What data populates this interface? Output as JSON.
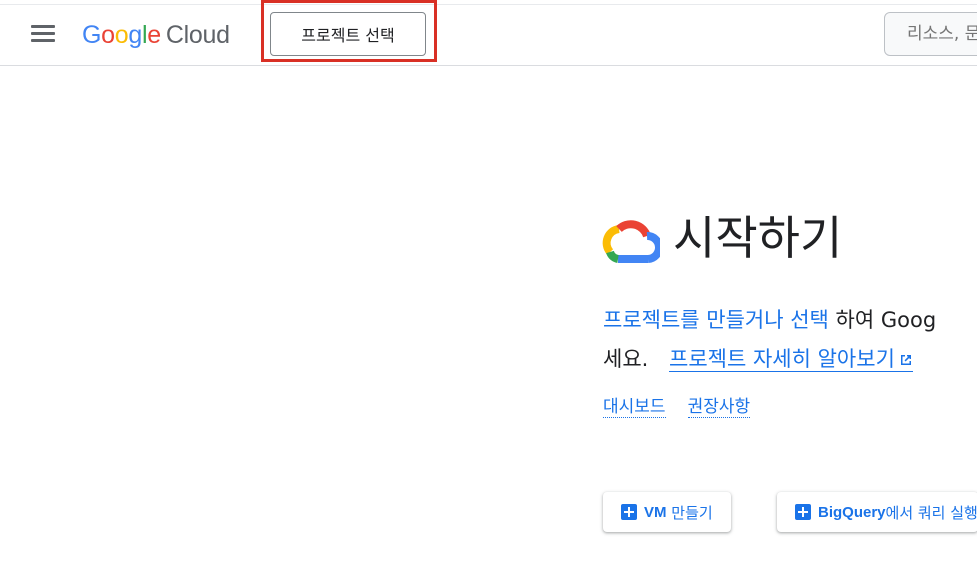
{
  "header": {
    "menu_icon": "hamburger-menu-icon",
    "logo": {
      "google": [
        "G",
        "o",
        "o",
        "g",
        "l",
        "e"
      ],
      "google_colors": [
        "#4285F4",
        "#EA4335",
        "#FBBC05",
        "#4285F4",
        "#34A853",
        "#EA4335"
      ],
      "cloud": "Cloud"
    },
    "project_button_label": "프로젝트 선택",
    "search_placeholder": "리소스, 문"
  },
  "main": {
    "heading": "시작하기",
    "description": {
      "link_select_project": "프로젝트를 만들거나 선택",
      "text_middle": " 하여 Goog",
      "text_end": "세요.",
      "link_learn_more": "프로젝트 자세히 알아보기",
      "learn_more_icon": "external-link-icon"
    },
    "sublinks": [
      "대시보드",
      "권장사항"
    ],
    "actions": [
      {
        "bold": "VM",
        "rest": " 만들기",
        "icon": "plus-icon"
      },
      {
        "bold": "BigQuery",
        "rest": "에서 쿼리 실행",
        "icon": "plus-icon"
      }
    ]
  },
  "colors": {
    "accent": "#1a73e8",
    "highlight": "#d93025"
  }
}
